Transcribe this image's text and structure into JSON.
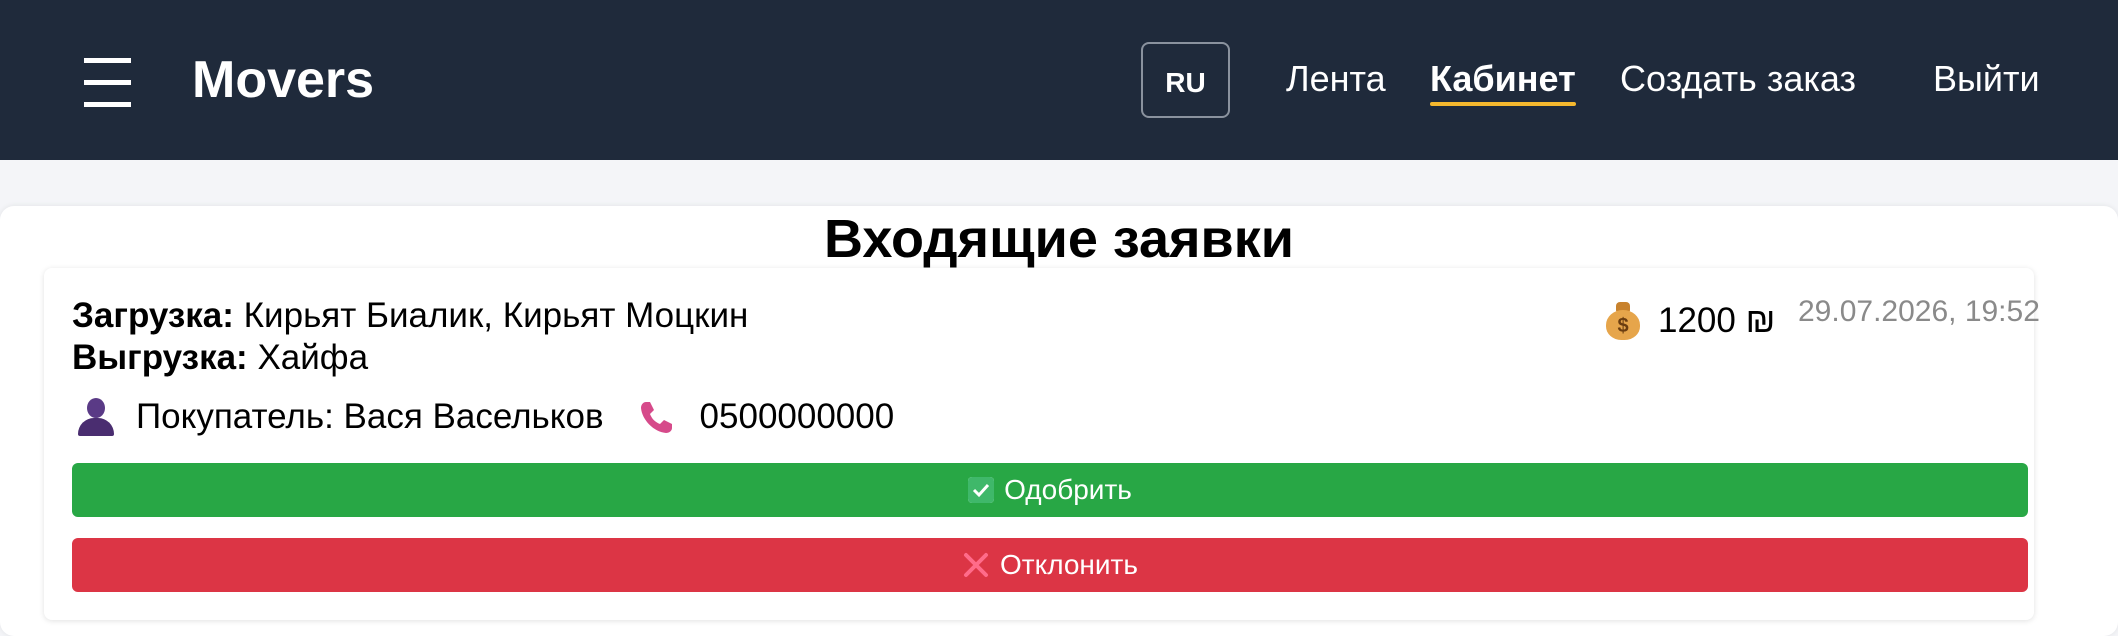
{
  "header": {
    "brand": "Movers",
    "language": "RU",
    "nav": {
      "feed": "Лента",
      "cabinet": "Кабинет",
      "create_order": "Создать заказ",
      "logout": "Выйти"
    }
  },
  "page": {
    "title": "Входящие заявки"
  },
  "request": {
    "load_label": "Загрузка:",
    "load_value": "Кирьят Биалик, Кирьят Моцкин",
    "unload_label": "Выгрузка:",
    "unload_value": "Хайфа",
    "price": "1200 ₪",
    "date": "29.07.2026, 19:52",
    "buyer": "Покупатель: Вася Васельков",
    "phone": "0500000000",
    "approve_label": "Одобрить",
    "reject_label": "Отклонить"
  },
  "colors": {
    "header_bg": "#1f2a3b",
    "active_underline": "#f5b82e",
    "approve": "#28a745",
    "reject": "#dc3545"
  },
  "icons": {
    "menu": "hamburger-icon",
    "price": "money-bag-icon",
    "buyer": "person-icon",
    "phone": "phone-icon",
    "approve": "check-icon",
    "reject": "cross-icon"
  }
}
